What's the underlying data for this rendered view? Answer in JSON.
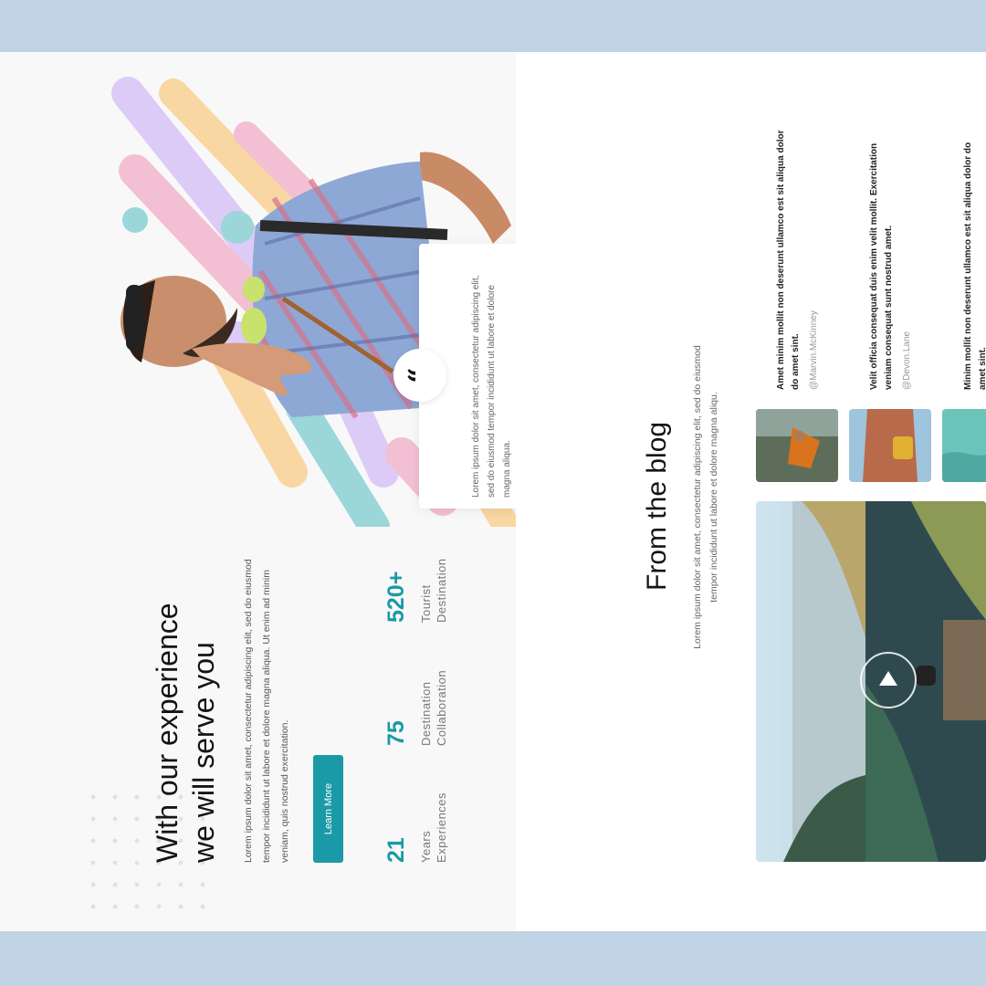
{
  "hero": {
    "title_line1": "With our experience",
    "title_line2": "we will serve you",
    "description": "Lorem ipsum dolor sit amet, consectetur adipiscing elit, sed do eiusmod tempor incididunt ut labore et dolore magna aliqua. Ut enim ad minim veniam, quis nostrud exercitation.",
    "button_label": "Learn More",
    "stats": [
      {
        "value": "21",
        "label_line1": "Years",
        "label_line2": "Experiences"
      },
      {
        "value": "75",
        "label_line1": "Destination",
        "label_line2": "Collaboration"
      },
      {
        "value": "520+",
        "label_line1": "Tourist",
        "label_line2": "Destination"
      }
    ]
  },
  "testimonial": {
    "quote_glyph": "“",
    "text": "Lorem ipsum dolor sit amet, consectetur adipiscing elit, sed do eiusmod tempor incididunt ut labore et dolore magna aliqua."
  },
  "blog": {
    "title": "From the blog",
    "description": "Lorem ipsum dolor sit amet, consectetur adipiscing elit, sed do eiusmod tempor incididunt ut labore et dolore magna aliqu.",
    "posts": [
      {
        "text": "Amet minim mollit non deserunt ullamco est sit aliqua dolor do amet sint.",
        "author": "@Marvin.McKinney"
      },
      {
        "text": "Velit officia consequat duis enim velit mollit. Exercitation veniam consequat sunt nostrud amet.",
        "author": "@Devon.Lane"
      },
      {
        "text": "Minim mollit non deserunt ullamco est sit aliqua dolor do amet sint.",
        "author": ""
      }
    ]
  },
  "colors": {
    "accent": "#1a9aa6",
    "frame": "#bfd3e4",
    "stripe_purple": "#dccbf6",
    "stripe_pink": "#f3bfd3",
    "stripe_yellow": "#f9d7a2",
    "stripe_teal": "#9bd6d9"
  },
  "icons": {
    "quote": "quote-icon",
    "play": "play-icon"
  }
}
